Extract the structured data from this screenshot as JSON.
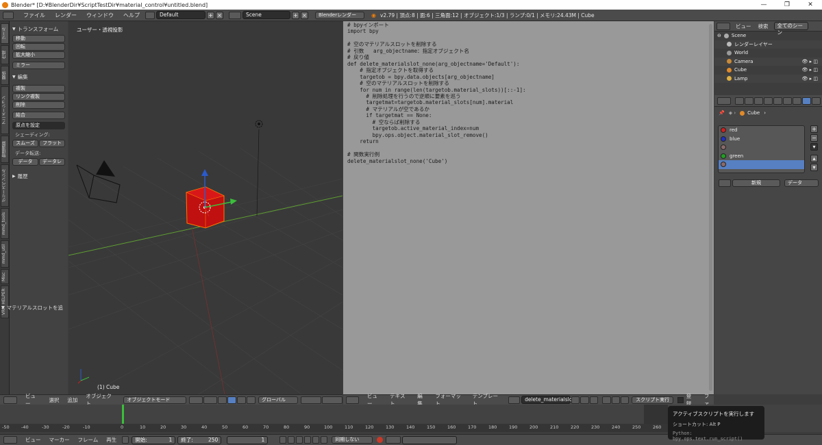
{
  "window": {
    "title": "Blender* [D:¥BlenderDir¥ScriptTestDir¥material_control¥untitled.blend]",
    "controls": [
      "—",
      "❐",
      "✕"
    ]
  },
  "topbar": {
    "menus": [
      "ファイル",
      "レンダー",
      "ウィンドウ",
      "ヘルプ"
    ],
    "layout": "Default",
    "scene": "Scene",
    "engine": "Blenderレンダー",
    "info": "v2.79 | 頂点:8 | 面:6 | 三角面:12 | オブジェクト:1/3 | ランプ:0/1 | メモリ:24.43M | Cube"
  },
  "left_tabs": [
    "ツール",
    "作成",
    "関係",
    "アニメーション",
    "物理演算",
    "グリースペンシル",
    "mmd_tools",
    "mmd_util",
    "Misc",
    "VRM HELPER"
  ],
  "toolshelf": {
    "transform_header": "トランスフォーム",
    "transform_buttons": [
      "移動",
      "回転",
      "拡大縮小"
    ],
    "mirror": "ミラー",
    "edit_header": "編集",
    "edit_buttons": [
      "複製",
      "リンク複製",
      "削除"
    ],
    "join": "結合",
    "origin": "原点を設定",
    "shading_label": "シェーディング:",
    "smooth": "スムーズ",
    "flat": "フラット",
    "data_transfer_label": "データ転送:",
    "data": "データ",
    "data_linked": "データレ",
    "history_header": "履歴",
    "material_slot_header": "マテリアルスロットを追"
  },
  "viewport": {
    "title": "ユーザー・透視投影",
    "object_label": "(1) Cube",
    "header": {
      "menus": [
        "ビュー",
        "選択",
        "追加",
        "オブジェクト"
      ],
      "mode": "オブジェクトモード",
      "orientation": "グローバル"
    }
  },
  "text_editor": {
    "code": "# bpyインポート\nimport bpy\n\n# 空のマテリアルスロットを削除する\n# 引数   arg_objectname：指定オブジェクト名\n# 戻り値\ndef delete_materialslot_none(arg_objectname='Default'):\n    # 指定オブジェクトを取得する\n    targetob = bpy.data.objects[arg_objectname]\n    # 空のマテリアルスロットを削除する\n    for num in range(len(targetob.material_slots))[::-1]:\n      # 削除処理を行うので逆順に要素を巡う\n      targetmat=targetob.material_slots[num].material\n      # マテリアルが空であるか\n      if targetmat == None:\n        # 空ならば削除する\n        targetob.active_material_index=num\n        bpy.ops.object.material_slot_remove()\n    return\n\n# 関数実行例\ndelete_materialslot_none('Cube')",
    "header": {
      "menus": [
        "ビュー",
        "テキスト",
        "編集",
        "フォーマット",
        "テンプレート"
      ],
      "file": "delete_materialslot...",
      "run": "スクリプト実行",
      "register": "登録",
      "more": "ファ"
    }
  },
  "outliner": {
    "view": "ビュー",
    "search": "検索",
    "filter": "全てのシーン",
    "items": [
      "Scene",
      "レンダーレイヤー",
      "World",
      "Camera",
      "Cube",
      "Lamp"
    ]
  },
  "properties": {
    "breadcrumb": "Cube",
    "slots": [
      {
        "name": "red",
        "color": "#cc2020"
      },
      {
        "name": "blue",
        "color": "#2030c0"
      },
      {
        "name": "",
        "color": "#8a6a6a"
      },
      {
        "name": "green",
        "color": "#20a020"
      },
      {
        "name": "",
        "color": "#8a6a6a"
      }
    ],
    "new": "新規",
    "data": "データ"
  },
  "timeline": {
    "ticks": [
      "-50",
      "-40",
      "-30",
      "-20",
      "-10",
      "0",
      "10",
      "20",
      "30",
      "40",
      "50",
      "60",
      "70",
      "80",
      "90",
      "100",
      "110",
      "120",
      "130",
      "140",
      "150",
      "160",
      "170",
      "180",
      "190",
      "200",
      "210",
      "220",
      "230",
      "240",
      "250",
      "260"
    ],
    "menus": [
      "ビュー",
      "マーカー",
      "フレーム",
      "再生"
    ],
    "start": "開始:",
    "start_val": "1",
    "end": "終了:",
    "end_val": "250",
    "current": "1",
    "sync": "同期しない"
  },
  "tooltip": {
    "title": "アクティブスクリプトを実行します",
    "shortcut": "ショートカット: Alt P",
    "python": "Python: bpy.ops.text.run_script()"
  }
}
